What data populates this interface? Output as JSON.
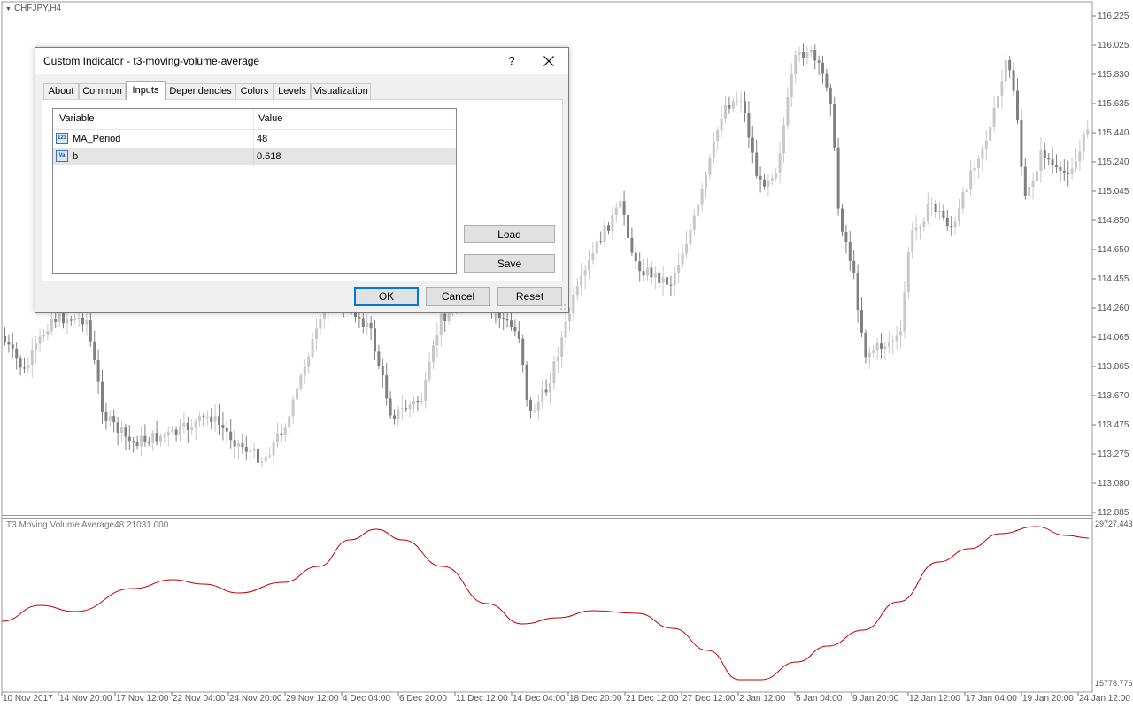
{
  "chart": {
    "symbol": "CHFJPY,H4",
    "price_axis": [
      "116.225",
      "116.025",
      "115.830",
      "115.635",
      "115.440",
      "115.240",
      "115.045",
      "114.850",
      "114.650",
      "114.455",
      "114.260",
      "114.065",
      "113.865",
      "113.670",
      "113.475",
      "113.275",
      "113.080",
      "112.885"
    ],
    "time_axis": [
      "10 Nov 2017",
      "14 Nov 20:00",
      "17 Nov 12:00",
      "22 Nov 04:00",
      "24 Nov 20:00",
      "29 Nov 12:00",
      "4 Dec 04:00",
      "6 Dec 20:00",
      "11 Dec 12:00",
      "14 Dec 04:00",
      "18 Dec 20:00",
      "21 Dec 12:00",
      "27 Dec 12:00",
      "2 Jan 12:00",
      "5 Jan 04:00",
      "9 Jan 20:00",
      "12 Jan 12:00",
      "17 Jan 04:00",
      "19 Jan 20:00",
      "24 Jan 12:00"
    ],
    "subwindow": {
      "label": "T3 Moving Volume Average48 21031.000",
      "scale_max": "29727.443",
      "scale_min": "15778.776",
      "line_color": "#c00000"
    }
  },
  "dialog": {
    "title": "Custom Indicator - t3-moving-volume-average",
    "help": "?",
    "tabs": [
      "About",
      "Common",
      "Inputs",
      "Dependencies",
      "Colors",
      "Levels",
      "Visualization"
    ],
    "active_tab": "Inputs",
    "table": {
      "headers": [
        "Variable",
        "Value"
      ],
      "rows": [
        {
          "icon": "123",
          "variable": "MA_Period",
          "value": "48"
        },
        {
          "icon": "Va",
          "variable": "b",
          "value": "0.618"
        }
      ]
    },
    "buttons": {
      "load": "Load",
      "save": "Save",
      "ok": "OK",
      "cancel": "Cancel",
      "reset": "Reset"
    }
  }
}
